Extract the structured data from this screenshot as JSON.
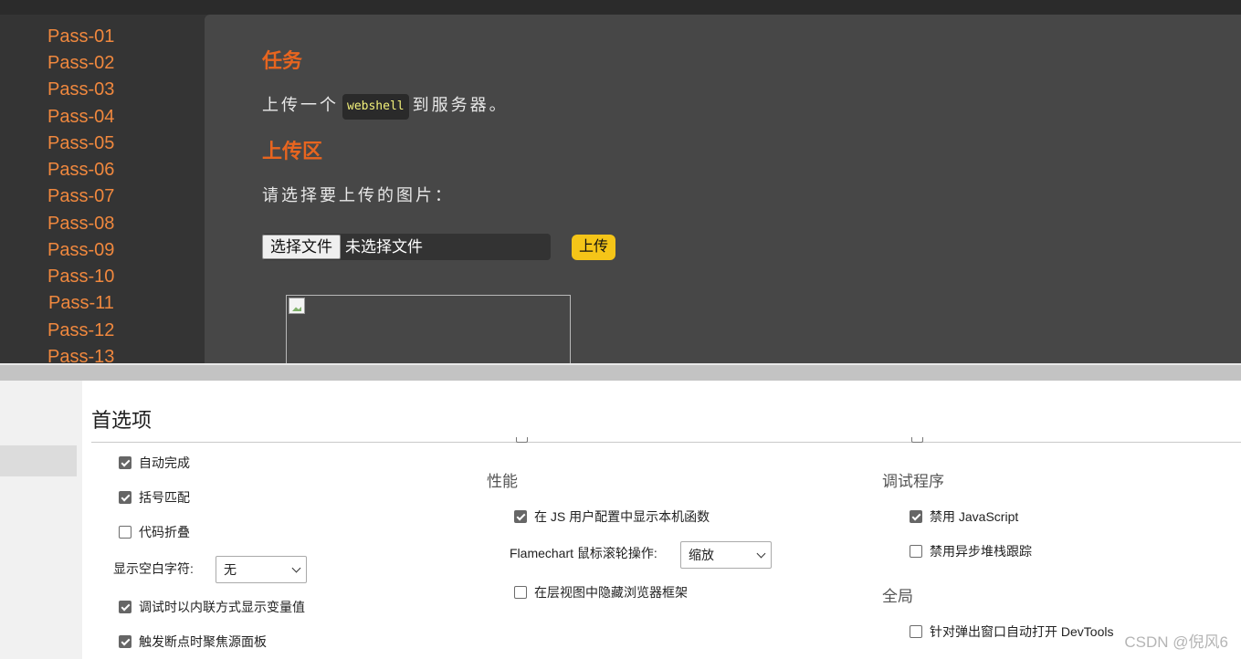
{
  "webpage": {
    "sidebar_links": [
      "Pass-01",
      "Pass-02",
      "Pass-03",
      "Pass-04",
      "Pass-05",
      "Pass-06",
      "Pass-07",
      "Pass-08",
      "Pass-09",
      "Pass-10",
      "Pass-11",
      "Pass-12",
      "Pass-13"
    ],
    "task_heading": "任务",
    "task_prefix": "上传一个",
    "task_code": "webshell",
    "task_suffix": "到服务器。",
    "upload_heading": "上传区",
    "choose_prompt": "请选择要上传的图片：",
    "choose_file_button": "选择文件",
    "no_file_text": "未选择文件",
    "upload_button": "上传"
  },
  "devtools": {
    "title": "首选项",
    "col1": {
      "autocomplete": {
        "label": "自动完成",
        "checked": true
      },
      "bracket_match": {
        "label": "括号匹配",
        "checked": true
      },
      "code_folding": {
        "label": "代码折叠",
        "checked": false
      },
      "whitespace_label": "显示空白字符:",
      "whitespace_value": "无",
      "inline_values": {
        "label": "调试时以内联方式显示变量值",
        "checked": true
      },
      "focus_sources": {
        "label": "触发断点时聚焦源面板",
        "checked": true
      }
    },
    "col2": {
      "section": "性能",
      "native_functions": {
        "label": "在 JS 用户配置中显示本机函数",
        "checked": true
      },
      "flamechart_label": "Flamechart 鼠标滚轮操作:",
      "flamechart_value": "缩放",
      "hide_frames": {
        "label": "在层视图中隐藏浏览器框架",
        "checked": false
      }
    },
    "col3": {
      "debugger_section": "调试程序",
      "disable_js": {
        "label": "禁用 JavaScript",
        "checked": true
      },
      "disable_async": {
        "label": "禁用异步堆栈跟踪",
        "checked": false
      },
      "global_section": "全局",
      "auto_open_popup": {
        "label": "针对弹出窗口自动打开 DevTools",
        "checked": false
      }
    }
  },
  "watermark": "CSDN @倪风6"
}
